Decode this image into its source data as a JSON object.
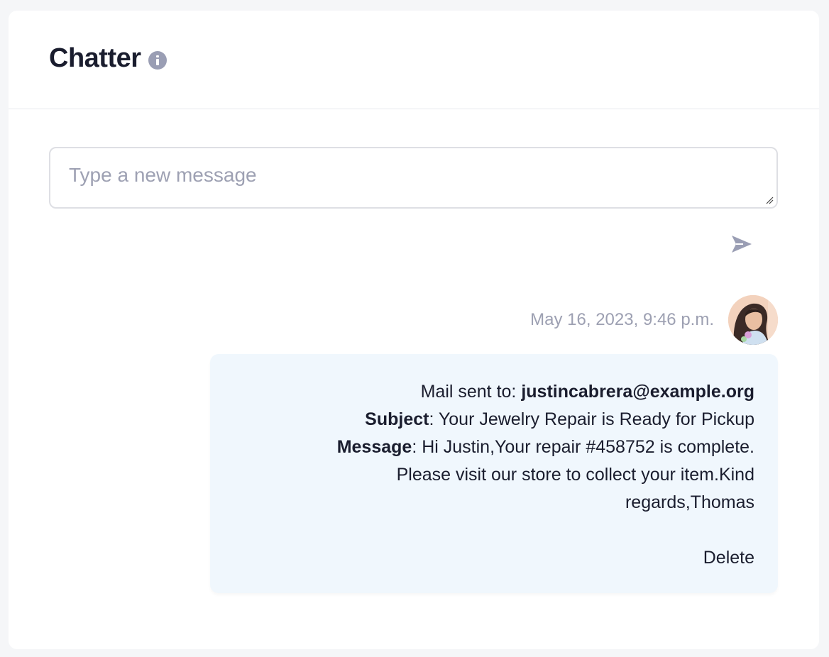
{
  "header": {
    "title": "Chatter",
    "info_icon": "info-icon"
  },
  "composer": {
    "placeholder": "Type a new message",
    "value": "",
    "send_icon": "send-icon"
  },
  "messages": [
    {
      "timestamp": "May 16, 2023, 9:46 p.m.",
      "avatar_icon": "user-avatar",
      "mail_label": "Mail sent to: ",
      "mail_to": "justincabrera@example.org",
      "subject_label": "Subject",
      "subject": ": Your Jewelry Repair is Ready for Pickup",
      "message_label": "Message",
      "message": ": Hi Justin,Your repair #458752 is complete. Please visit our store to collect your item.Kind regards,Thomas",
      "delete_label": "Delete"
    }
  ],
  "colors": {
    "background": "#f5f6f8",
    "card": "#ffffff",
    "bubble": "#f0f7fd",
    "muted_text": "#9da0b2",
    "text": "#1a1d2e"
  }
}
